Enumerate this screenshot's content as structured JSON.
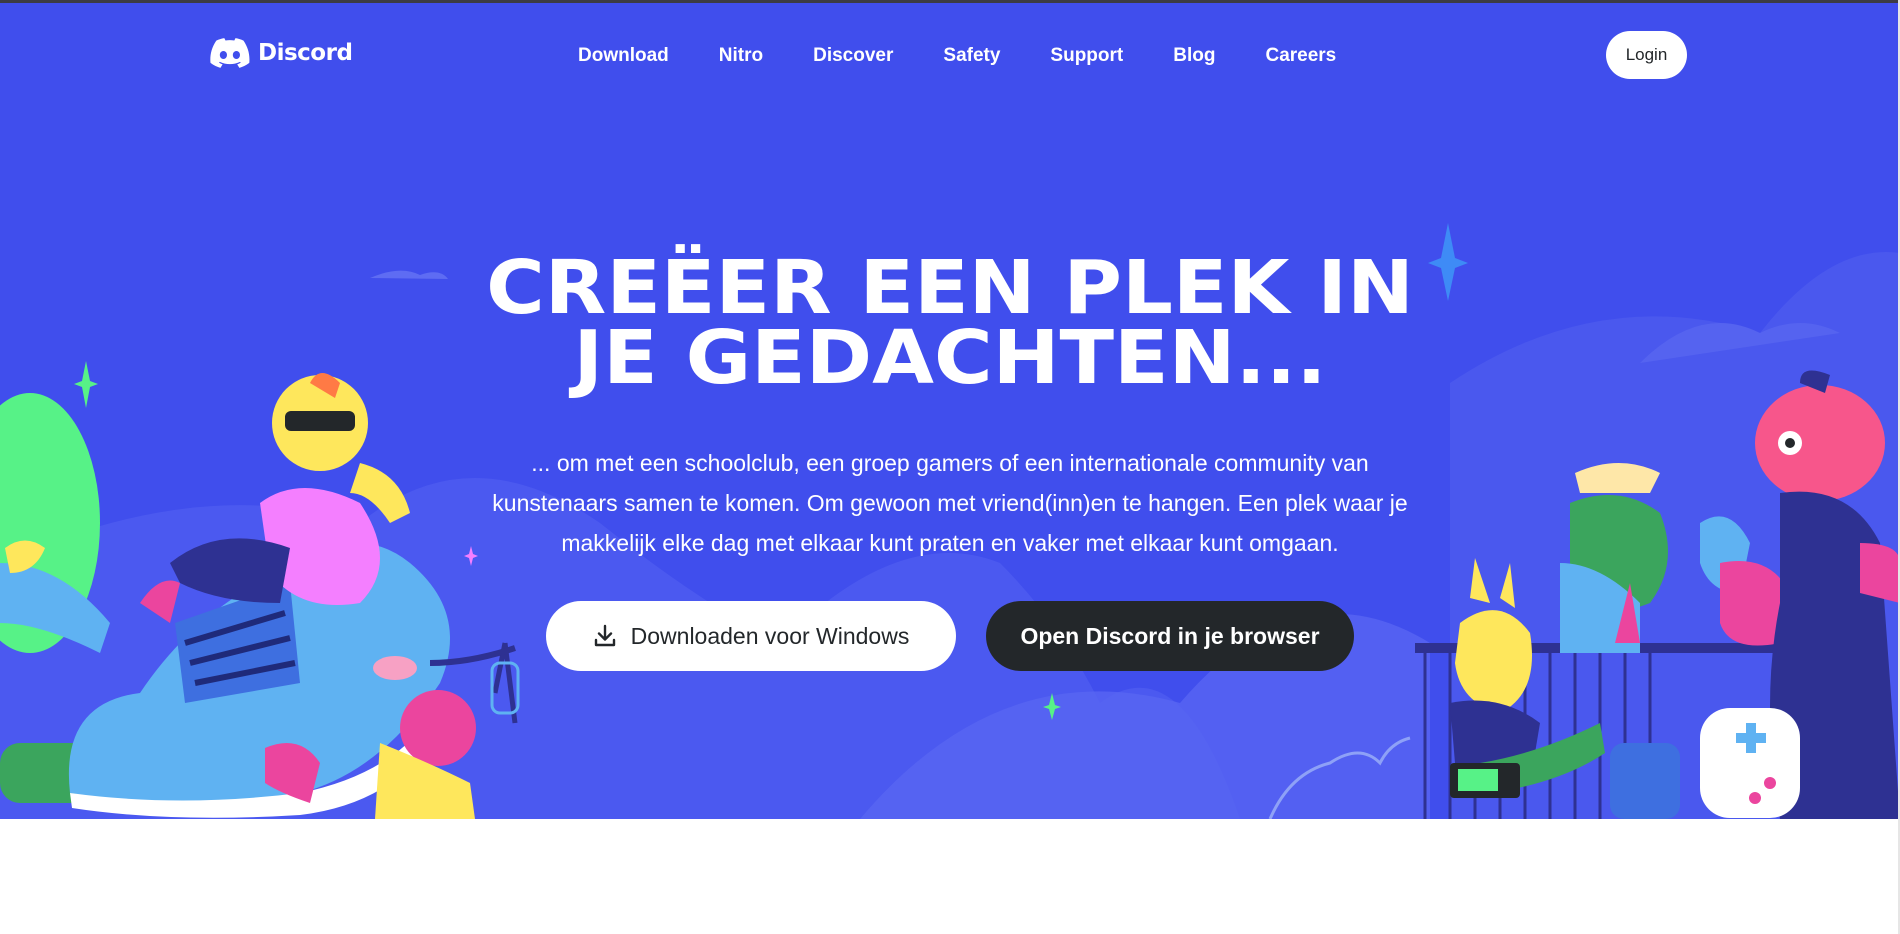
{
  "brand": {
    "name": "Discord"
  },
  "nav": {
    "links": [
      "Download",
      "Nitro",
      "Discover",
      "Safety",
      "Support",
      "Blog",
      "Careers"
    ],
    "login_label": "Login"
  },
  "hero": {
    "headline_line1": "CREËER EEN PLEK IN",
    "headline_line2": "JE GEDACHTEN...",
    "lead_line1": "... om met een schoolclub, een groep gamers of een internationale community van",
    "lead_line2": "kunstenaars samen te komen. Om gewoon met vriend(inn)en te hangen. Een plek waar je",
    "lead_line3": "makkelijk elke dag met elkaar kunt praten en vaker met elkaar kunt omgaan.",
    "download_label": "Downloaden voor Windows",
    "open_browser_label": "Open Discord in je browser"
  },
  "colors": {
    "blurple": "#404eed",
    "dark": "#23272a",
    "white": "#ffffff"
  },
  "icons": {
    "logo": "discord-logo-icon",
    "download": "download-icon"
  }
}
